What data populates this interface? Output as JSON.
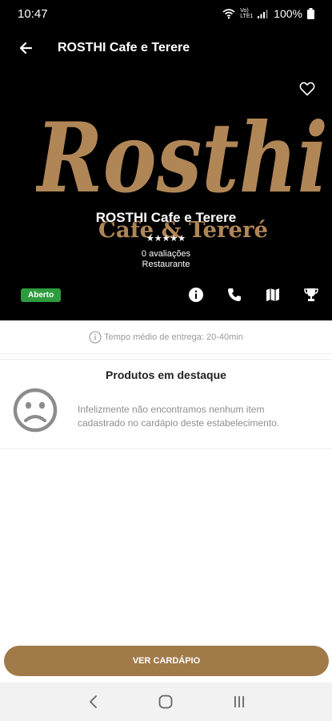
{
  "status_bar": {
    "time": "10:47",
    "network_label": "Vo) LTE1",
    "battery": "100%",
    "icons": [
      "wifi-icon",
      "signal-icon",
      "battery-icon"
    ]
  },
  "app_bar": {
    "title": "ROSTHI Cafe e Terere",
    "back_icon": "arrow-left-icon",
    "favorite_icon": "heart-outline-icon"
  },
  "hero": {
    "logo_text_main": "Rosthi",
    "logo_text_sub": "Cafe & Tereré",
    "logo_color": "#b08657",
    "store_name": "ROSTHI Cafe e Terere",
    "stars": "★★★★★",
    "reviews": "0 avaliações",
    "category": "Restaurante",
    "status_badge": "Aberto",
    "status_color": "#2e9b3f",
    "actions": [
      "info-icon",
      "phone-icon",
      "map-icon",
      "trophy-icon"
    ]
  },
  "delivery": {
    "text": "Tempo médio de entrega: 20-40min",
    "icon": "info-circle-icon"
  },
  "featured": {
    "title": "Produtos em destaque",
    "empty_icon": "sad-face-icon",
    "empty_message": "Infelizmente não encontramos nenhum item cadastrado no cardápio deste estabelecimento."
  },
  "cta": {
    "label": "VER CARDÁPIO",
    "color": "#a17a4a"
  },
  "nav_bar": {
    "buttons": [
      "back-nav-icon",
      "home-nav-icon",
      "recents-nav-icon"
    ]
  }
}
